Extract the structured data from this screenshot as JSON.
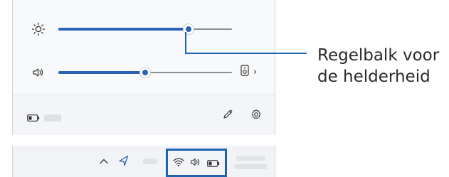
{
  "quick_settings": {
    "brightness": {
      "icon": "sun-icon",
      "level": 0.75
    },
    "volume": {
      "icon": "speaker-icon",
      "level": 0.5,
      "output_icon": "audio-device-icon",
      "output_chevron": "›"
    },
    "footer": {
      "battery_icon": "battery-icon",
      "edit_icon": "pencil-icon",
      "settings_icon": "gear-icon"
    }
  },
  "taskbar": {
    "chevron_icon": "chevron-up-icon",
    "location_icon": "location-arrow-icon",
    "tray_icons": [
      "wifi-icon",
      "speaker-icon",
      "battery-icon"
    ]
  },
  "callout": {
    "line1": "Regelbalk voor",
    "line2": "de helderheid"
  },
  "colors": {
    "accent": "#2b62b6",
    "highlight": "#1e63ad",
    "panel_bg": "#f3f5f8"
  }
}
